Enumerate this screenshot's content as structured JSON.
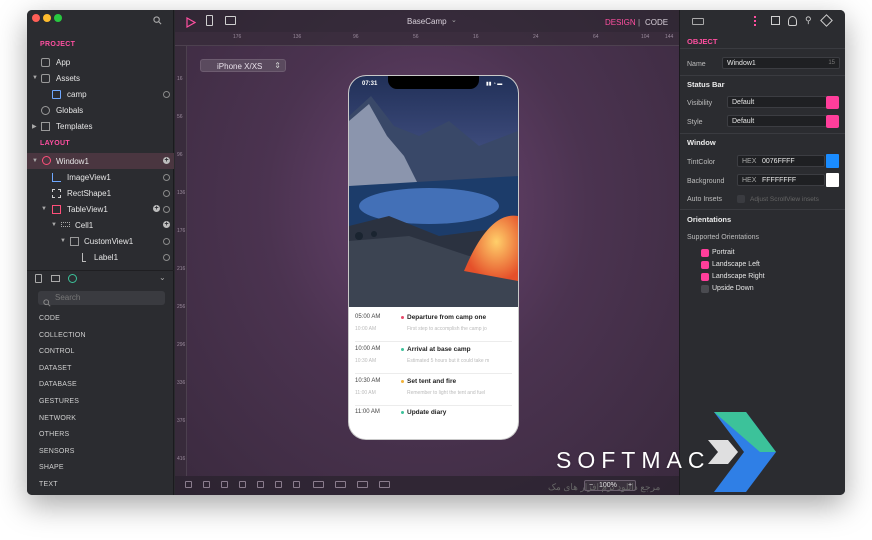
{
  "left_panel": {
    "project_label": "PROJECT",
    "project_items": [
      "App",
      "Assets",
      "camp",
      "Globals",
      "Templates"
    ],
    "layout_label": "LAYOUT",
    "layout_items": [
      "Window1",
      "ImageView1",
      "RectShape1",
      "TableView1",
      "Cell1",
      "CustomView1",
      "Label1"
    ],
    "library_search_placeholder": "Search",
    "categories": [
      "CODE",
      "COLLECTION",
      "CONTROL",
      "DATASET",
      "DATABASE",
      "GESTURES",
      "NETWORK",
      "OTHERS",
      "SENSORS",
      "SHAPE",
      "TEXT"
    ]
  },
  "toolbar": {
    "project_name": "BaseCamp",
    "design_label": "DESIGN",
    "separator": "|",
    "code_label": "CODE"
  },
  "canvas": {
    "device_selector": "iPhone X/XS",
    "ruler_top": [
      "176",
      "136",
      "96",
      "56",
      "16",
      "24",
      "64",
      "104",
      "144"
    ],
    "ruler_left": [
      "16",
      "56",
      "96",
      "136",
      "176",
      "216",
      "256",
      "296",
      "336",
      "376",
      "416"
    ],
    "zoom_minus": "−",
    "zoom_level": "100%",
    "zoom_plus": "+"
  },
  "phone": {
    "status_time": "07:31",
    "timeline": [
      {
        "time": "05:00 AM",
        "end": "10:00 AM",
        "title": "Departure from camp one",
        "sub": "First step to accomplish the camp jo",
        "dot": "#e84a6a"
      },
      {
        "time": "10:00 AM",
        "end": "10:30 AM",
        "title": "Arrival at base camp",
        "sub": "Estimated 5 hours but it could take m",
        "dot": "#3cc29a"
      },
      {
        "time": "10:30 AM",
        "end": "11:00 AM",
        "title": "Set tent and fire",
        "sub": "Remember to light the tent and fuel",
        "dot": "#f2b23a"
      },
      {
        "time": "11:00 AM",
        "end": "",
        "title": "Update diary",
        "sub": "",
        "dot": "#3cc29a"
      }
    ]
  },
  "inspector": {
    "object_label": "OBJECT",
    "name_label": "Name",
    "name_value": "Window1",
    "name_num": "15",
    "status_bar_label": "Status Bar",
    "visibility_label": "Visibility",
    "visibility_value": "Default",
    "style_label": "Style",
    "style_value": "Default",
    "window_label": "Window",
    "tint_label": "TintColor",
    "tint_hex_label": "HEX",
    "tint_value": "0076FFFF",
    "tint_color": "#1a8cff",
    "background_label": "Background",
    "bg_hex_label": "HEX",
    "bg_value": "FFFFFFFF",
    "bg_color": "#ffffff",
    "auto_insets_label": "Auto Insets",
    "adjust_label": "Adjust ScrollView insets",
    "orientations_label": "Orientations",
    "supported_label": "Supported Orientations",
    "orientations": [
      {
        "label": "Portrait",
        "checked": true
      },
      {
        "label": "Landscape Left",
        "checked": true
      },
      {
        "label": "Landscape Right",
        "checked": true
      },
      {
        "label": "Upside Down",
        "checked": false
      }
    ]
  },
  "colors": {
    "accent": "#ff4fa0",
    "panel": "#2b2c30"
  },
  "watermark": {
    "brand": "SOFTMAC",
    "subtitle": "مرجع دانلود نرم افزار های مک"
  }
}
